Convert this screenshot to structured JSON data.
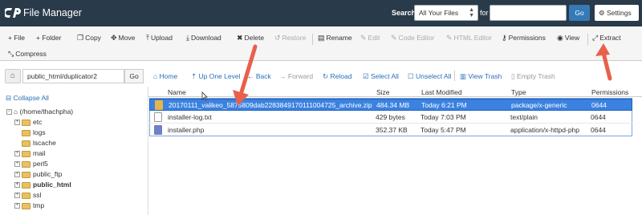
{
  "header": {
    "app_title": "File Manager",
    "search_label": "Search",
    "search_scope": "All Your Files",
    "for_label": "for",
    "search_query": "",
    "go_label": "Go",
    "settings_label": "Settings"
  },
  "toolbar": {
    "file": "+ File",
    "folder": "+ Folder",
    "copy": "Copy",
    "move": "Move",
    "upload": "Upload",
    "download": "Download",
    "delete": "Delete",
    "restore": "Restore",
    "rename": "Rename",
    "edit": "Edit",
    "code_editor": "Code Editor",
    "html_editor": "HTML Editor",
    "permissions": "Permissions",
    "view": "View",
    "extract": "Extract",
    "compress": "Compress"
  },
  "pathbar": {
    "path": "public_html/duplicator2",
    "go": "Go"
  },
  "navbar": {
    "home": "Home",
    "up": "Up One Level",
    "back": "Back",
    "forward": "Forward",
    "reload": "Reload",
    "select_all": "Select All",
    "unselect_all": "Unselect All",
    "view_trash": "View Trash",
    "empty_trash": "Empty Trash"
  },
  "tree": {
    "collapse_all": "Collapse All",
    "root": "(/home/thachpha)",
    "items": [
      "etc",
      "logs",
      "lscache",
      "mail",
      "perl5",
      "public_ftp",
      "public_html",
      "ssl",
      "tmp"
    ]
  },
  "table": {
    "headers": [
      "Name",
      "Size",
      "Last Modified",
      "Type",
      "Permissions"
    ],
    "rows": [
      {
        "name": "20170111_valikeo_5875809dab2283849170111004725_archive.zip",
        "size": "484.34 MB",
        "modified": "Today 6:21 PM",
        "type": "package/x-generic",
        "perms": "0644"
      },
      {
        "name": "installer-log.txt",
        "size": "429 bytes",
        "modified": "Today 7:03 PM",
        "type": "text/plain",
        "perms": "0644"
      },
      {
        "name": "installer.php",
        "size": "352.37 KB",
        "modified": "Today 5:47 PM",
        "type": "application/x-httpd-php",
        "perms": "0644"
      }
    ]
  },
  "colors": {
    "header_bg": "#293a4a",
    "selection": "#3b82e0",
    "link": "#2a6fb5",
    "arrow": "#e8604c"
  }
}
